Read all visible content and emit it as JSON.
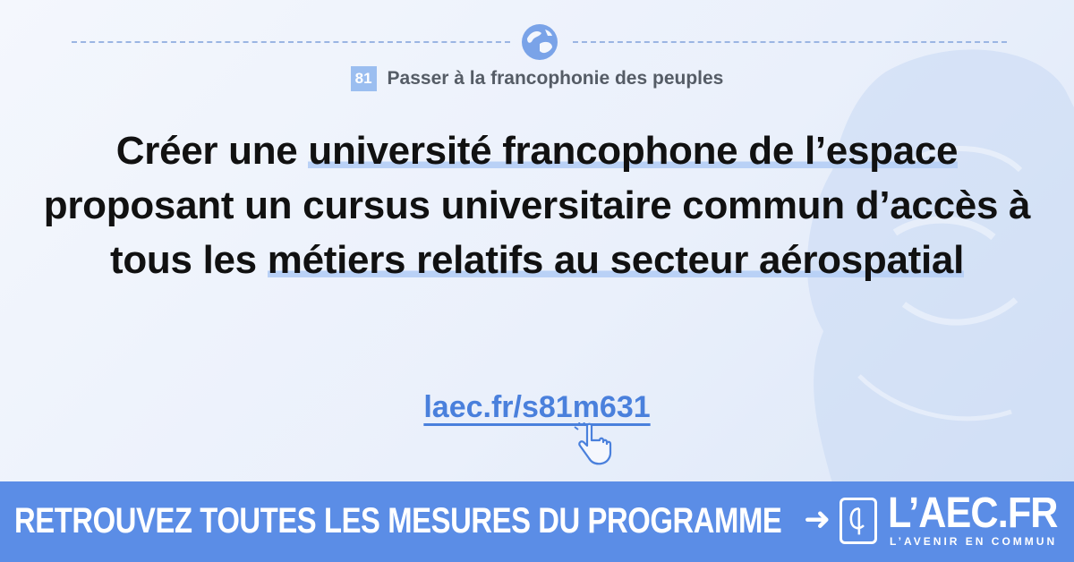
{
  "chapter": {
    "number": "81",
    "title": "Passer à la francophonie des peuples"
  },
  "headline": {
    "part1": "Créer une ",
    "highlight1": "université francophone de l’espace",
    "part2": " proposant un cursus universitaire commun d’accès à tous les ",
    "highlight2": "métiers relatifs au secteur aérospatial"
  },
  "link": {
    "text": "laec.fr/s81m631"
  },
  "banner": {
    "cta": "RETROUVEZ TOUTES LES MESURES DU PROGRAMME",
    "arrow": "➜",
    "logo": "L’AEC.FR",
    "logo_sub": "L’AVENIR EN COMMUN"
  },
  "icons": [
    "globe-icon",
    "pointer-hand-icon",
    "laec-logo-icon"
  ],
  "colors": {
    "accent": "#5b8de6",
    "link": "#4a80dc",
    "highlight": "#b9d1f6",
    "badge": "#9bbef0"
  }
}
